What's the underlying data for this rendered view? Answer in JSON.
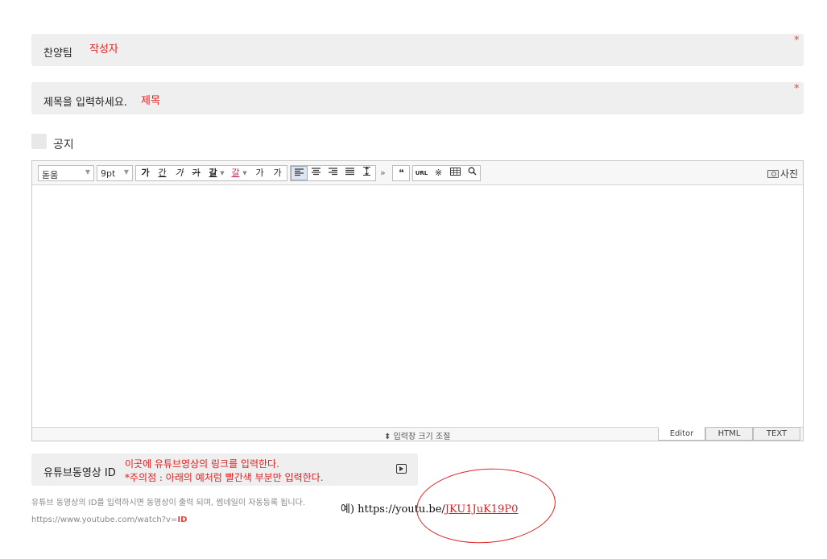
{
  "author_field": {
    "label": "찬양팀",
    "annotation": "작성자",
    "required_mark": "*"
  },
  "title_field": {
    "label": "제목을 입력하세요.",
    "annotation": "제목",
    "required_mark": "*"
  },
  "notice": {
    "label": "공지",
    "checked": false
  },
  "editor": {
    "font_select": "돋움",
    "size_select": "9pt",
    "format_buttons": [
      "가",
      "간",
      "가",
      "가",
      "갈",
      "갈",
      "가",
      "가"
    ],
    "align_buttons": [
      "align-left-icon",
      "align-center-icon",
      "align-right-icon",
      "align-justify-icon",
      "line-height-icon"
    ],
    "more_chevron": "»",
    "quote_button": "❝",
    "insert_buttons": [
      "URL",
      "※",
      "table-icon",
      "search-icon"
    ],
    "photo_button": "사진",
    "resize_label": "⬍ 입력창 크기 조절",
    "mode_tabs": [
      "Editor",
      "HTML",
      "TEXT"
    ],
    "active_mode": "Editor"
  },
  "youtube_field": {
    "label": "유튜브동영상 ID",
    "note_line1": "이곳에 유튜브영상의 링크를 입력한다.",
    "note_line2": "*주의점 : 아래의 예처럼 빨간색 부분만 입력한다."
  },
  "help": {
    "line1": "유튜브 동영상의 ID를 입력하시면 동영상이 출력 되며, 썸네일이 자동등록 됩니다.",
    "line2_prefix": "https://www.youtube.com/watch?v=",
    "line2_id": "ID"
  },
  "example": {
    "prefix": "예) https://youtu.be/",
    "id": "JKU1JuK19P0"
  },
  "colors": {
    "annotation_red": "#e02020",
    "field_bg": "#efefef",
    "required_red": "#e8453c"
  }
}
